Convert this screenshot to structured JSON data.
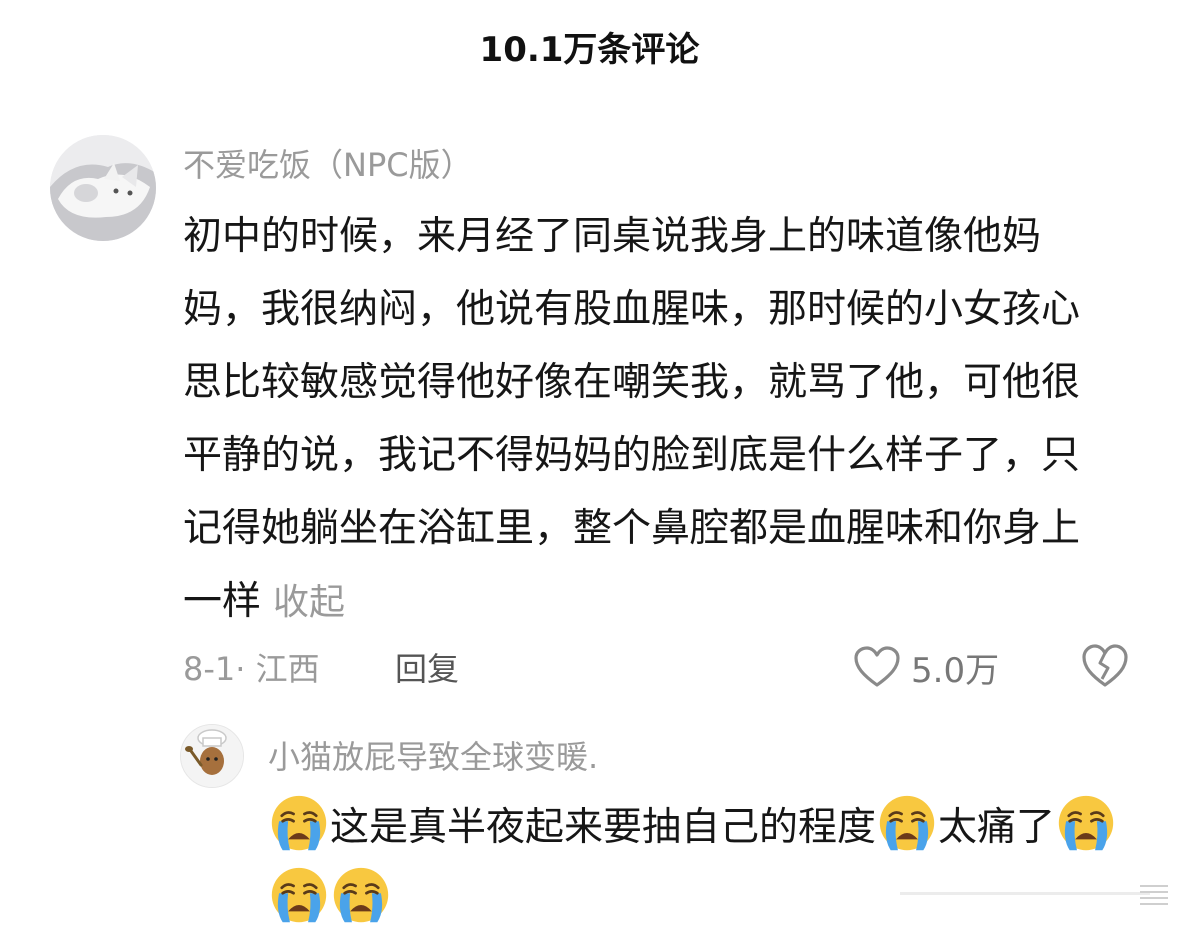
{
  "header": {
    "title": "10.1万条评论"
  },
  "comment": {
    "author": "不爱吃饭（NPC版）",
    "text": "初中的时候，来月经了同桌说我身上的味道像他妈妈，我很纳闷，他说有股血腥味，那时候的小女孩心思比较敏感觉得他好像在嘲笑我，就骂了他，可他很平静的说，我记不得妈妈的脸到底是什么样子了，只记得她躺坐在浴缸里，整个鼻腔都是血腥味和你身上一样",
    "collapse_label": "收起",
    "date": "8-1·",
    "location": "江西",
    "reply_label": "回复",
    "like_count": "5.0万",
    "icons": {
      "like": "heart-outline-icon",
      "dislike": "broken-heart-icon"
    }
  },
  "reply": {
    "author": "小猫放屁导致全球变暖.",
    "text_part1": "这是真半夜起来要抽自己的程度",
    "text_part2": "太痛了",
    "emoji": "loudly-crying-face"
  },
  "colors": {
    "text": "#161616",
    "muted": "#9a9a9a",
    "emoji_face": "#f8c840",
    "emoji_tear": "#4aa3ea"
  }
}
